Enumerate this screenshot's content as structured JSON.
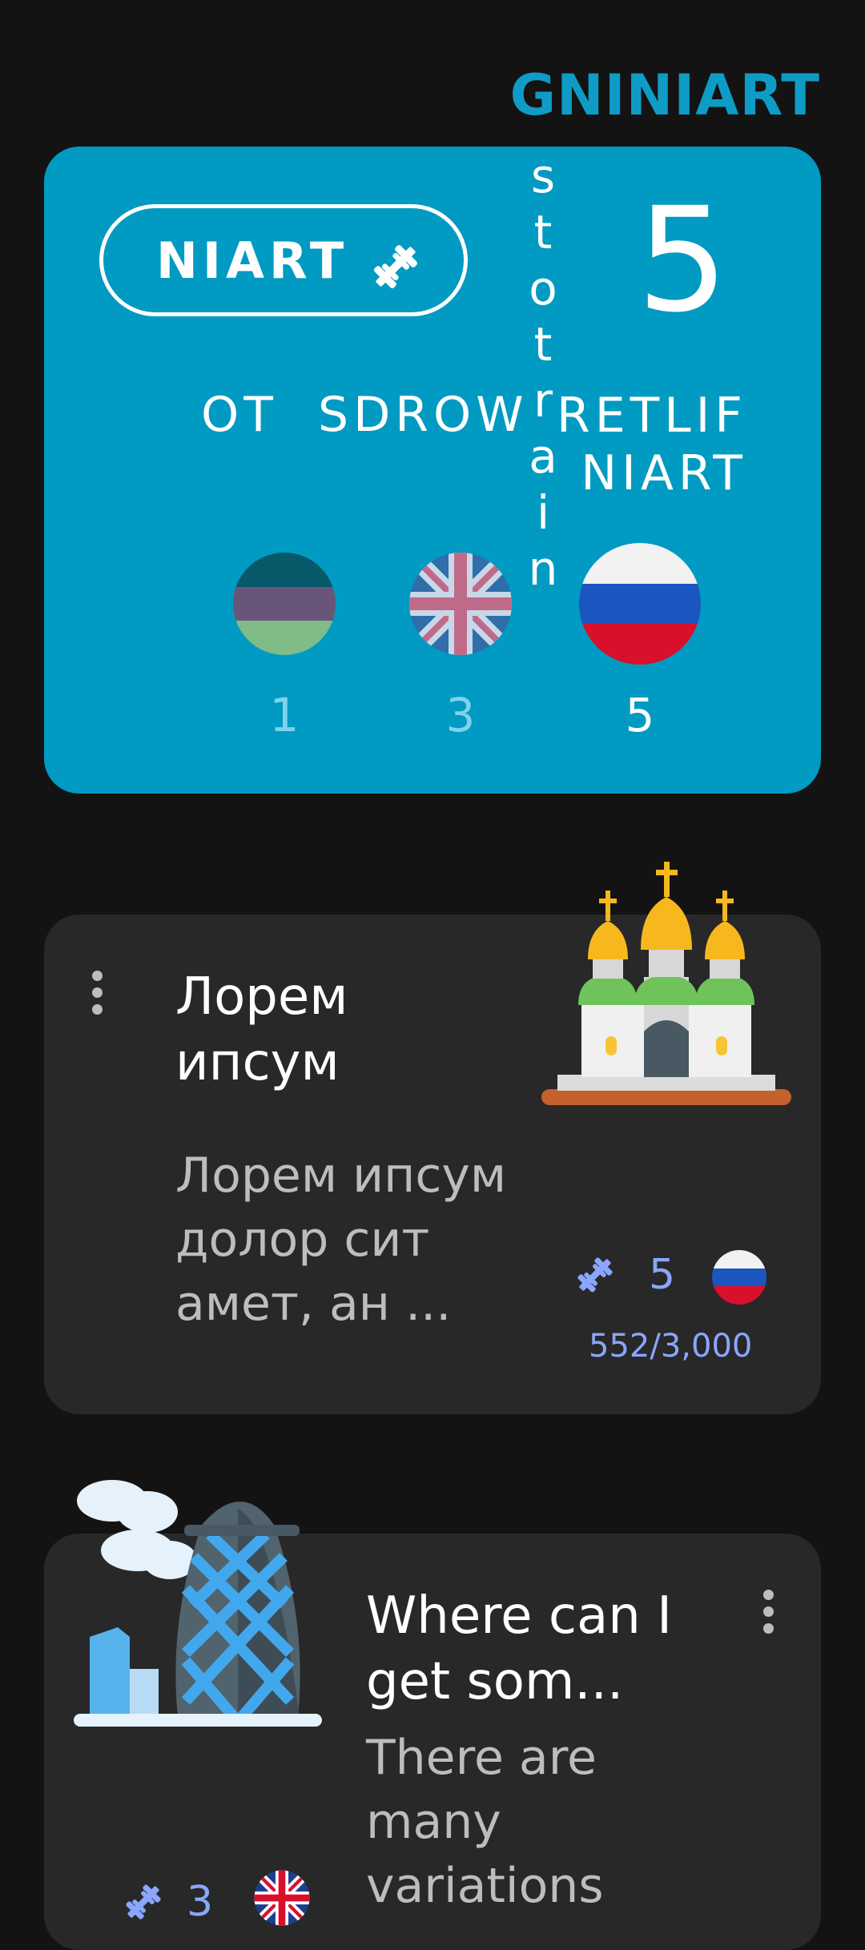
{
  "screen_title": "GNINIART",
  "training_card": {
    "train_button_label": "NIART",
    "train_button_icon": "dumbbell-icon",
    "vertical_text": [
      "s",
      "t",
      "o",
      "t",
      "r",
      "a",
      "i",
      "n"
    ],
    "total_count": "5",
    "words_to_label": "OT  SDROW",
    "filter_label_line1": "RETLIF",
    "filter_label_line2": "NIART",
    "languages": [
      {
        "flag": "purple-green-flag-icon",
        "count": "1",
        "active": false
      },
      {
        "flag": "uk-flag-icon",
        "count": "3",
        "active": false
      },
      {
        "flag": "russia-flag-icon",
        "count": "5",
        "active": true
      }
    ]
  },
  "posts": [
    {
      "title": "Лорем ипсум",
      "excerpt": "Лорем ипсум долор сит амет, ан ...",
      "image": "church-icon",
      "count": "5",
      "progress": "552/3,000",
      "flag": "russia-flag-icon"
    },
    {
      "title": "Where can I get som...",
      "excerpt": "There are many variations",
      "image": "gherkin-building-icon",
      "count": "3",
      "flag": "uk-flag-icon"
    }
  ],
  "colors": {
    "accent": "#009ac2",
    "title": "#0e9cc6",
    "card": "#282828",
    "background": "#131313",
    "meta": "#8aa6ff"
  }
}
